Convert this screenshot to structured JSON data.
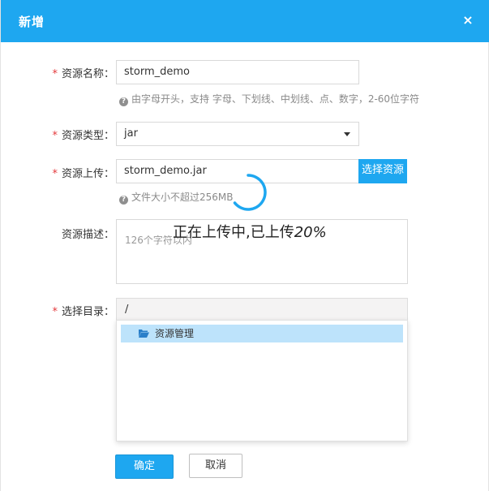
{
  "dialog": {
    "title": "新增",
    "close_icon": "×"
  },
  "form": {
    "name": {
      "label": "资源名称：",
      "value": "storm_demo",
      "hint": "由字母开头，支持 字母、下划线、中划线、点、数字，2-60位字符"
    },
    "type": {
      "label": "资源类型：",
      "selected": "jar"
    },
    "upload": {
      "label": "资源上传：",
      "value": "storm_demo.jar",
      "button": "选择资源",
      "hint": "文件大小不超过256MB"
    },
    "description": {
      "label": "资源描述：",
      "placeholder": "126个字符以内"
    },
    "directory": {
      "label": "选择目录：",
      "value": "/",
      "tree": [
        {
          "label": "资源管理",
          "icon": "folder-open-icon",
          "selected": true
        }
      ]
    }
  },
  "overlay": {
    "message": "正在上传中,已上传",
    "percent": "20%"
  },
  "buttons": {
    "ok": "确定",
    "cancel": "取消"
  },
  "required_mark": "*",
  "colors": {
    "accent": "#1ea7f0",
    "required": "#e4393c",
    "selected_node": "#bde3fb"
  }
}
